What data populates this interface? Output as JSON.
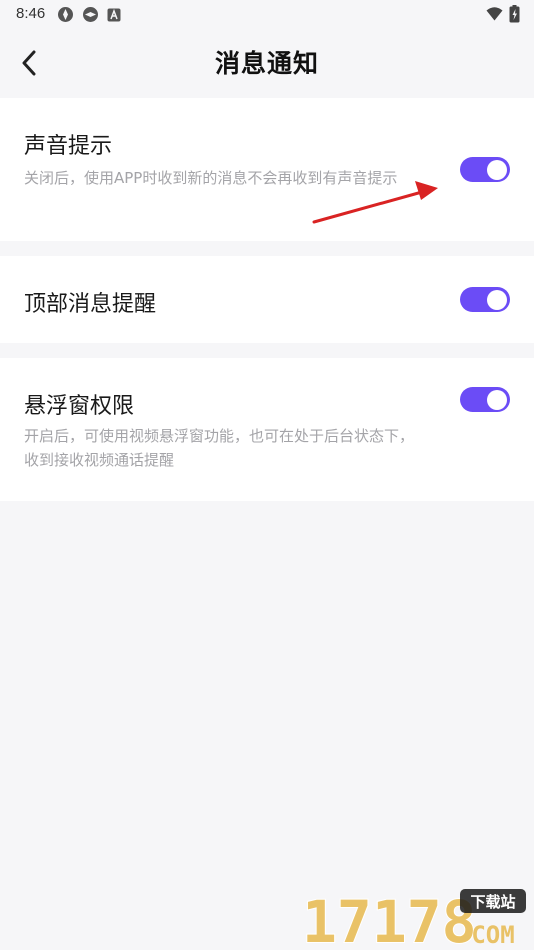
{
  "status_bar": {
    "time": "8:46",
    "left_icons": [
      "notification-icon-1",
      "notification-icon-2",
      "app-a-icon"
    ],
    "right_icons": [
      "wifi-icon",
      "battery-icon"
    ]
  },
  "header": {
    "title": "消息通知",
    "back_icon": "chevron-left-icon"
  },
  "settings": [
    {
      "title": "声音提示",
      "description": "关闭后，使用APP时收到新的消息不会再收到有声音提示",
      "enabled": true
    },
    {
      "title": "顶部消息提醒",
      "description": "",
      "enabled": true
    },
    {
      "title": "悬浮窗权限",
      "description": "开启后，可使用视频悬浮窗功能，也可在处于后台状态下，收到接收视频通话提醒",
      "enabled": true
    }
  ],
  "watermark": {
    "number_text": "17178",
    "badge_text": "下载站",
    "domain_text": "COM"
  },
  "colors": {
    "background": "#f6f6f8",
    "card": "#ffffff",
    "toggle_on": "#6b4cf6",
    "annotation_arrow": "#d92323",
    "watermark_gold": "#e6b84e"
  }
}
